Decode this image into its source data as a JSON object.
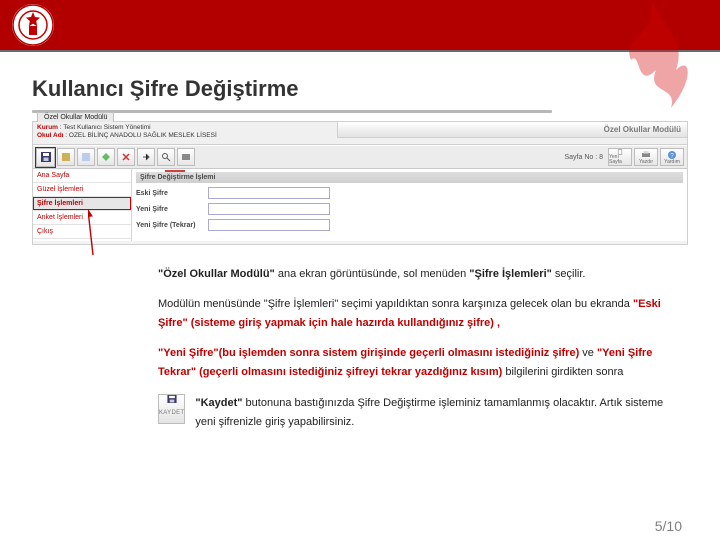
{
  "page": {
    "title": "Kullanıcı Şifre Değiştirme",
    "number": "5/10"
  },
  "screenshot": {
    "tab": "Özel Okullar Modülü",
    "login_line1_key": "Kurum",
    "login_line1_val": "Test Kullanıcı Sistem Yönetimi",
    "login_line2_key": "Okul Adı",
    "login_line2_val": "OZEL BİLİNÇ ANADOLU SAĞLIK MESLEK LİSESİ",
    "title_right": "Özel Okullar Modülü",
    "page_indicator": "Sayfa No : 8",
    "toolbar_end_1": "Yenı Sayfa",
    "toolbar_end_2": "Yazdır",
    "toolbar_end_3": "Yardım",
    "sidebar": {
      "items": [
        {
          "label": "Ana Sayfa",
          "selected": false
        },
        {
          "label": "Güzel İşlemleri",
          "selected": false
        },
        {
          "label": "Şifre İşlemleri",
          "selected": true
        },
        {
          "label": "Anket İşlemleri",
          "selected": false
        },
        {
          "label": "Çıkış",
          "selected": false
        }
      ]
    },
    "panel_title": "Şifre Değiştirme İşlemi",
    "fields": {
      "old": "Eski Şifre",
      "new": "Yeni Şifre",
      "again": "Yeni Şifre (Tekrar)"
    }
  },
  "body": {
    "p1_a": "\"Özel Okullar Modülü\"",
    "p1_b": " ana ekran görüntüsünde, sol menüden ",
    "p1_c": "\"Şifre İşlemleri\"",
    "p1_d": " seçilir.",
    "p2_a": "Modülün menüsünde \"Şifre İşlemleri\" seçimi yapıldıktan sonra karşınıza gelecek olan bu ekranda ",
    "p2_b": "\"Eski Şifre\" (sisteme giriş yapmak için hale hazırda kullandığınız şifre) ,",
    "p3_a": "\"Yeni Şifre\"",
    "p3_b": "(bu işlemden sonra sistem girişinde geçerli olmasını istediğiniz şifre)",
    "p3_c": " ve ",
    "p3_d": "\"Yeni Şifre Tekrar\" (geçerli olmasını istediğiniz şifreyi tekrar yazdığınız kısım)",
    "p3_e": " bilgilerini girdikten sonra",
    "p4_a": "\"Kaydet\"",
    "p4_b": " butonuna bastığınızda Şifre Değiştirme işleminiz tamamlanmış olacaktır. Artık sisteme yeni şifrenizle giriş yapabilirsiniz.",
    "kaydet_icon_label": "KAYDET"
  }
}
